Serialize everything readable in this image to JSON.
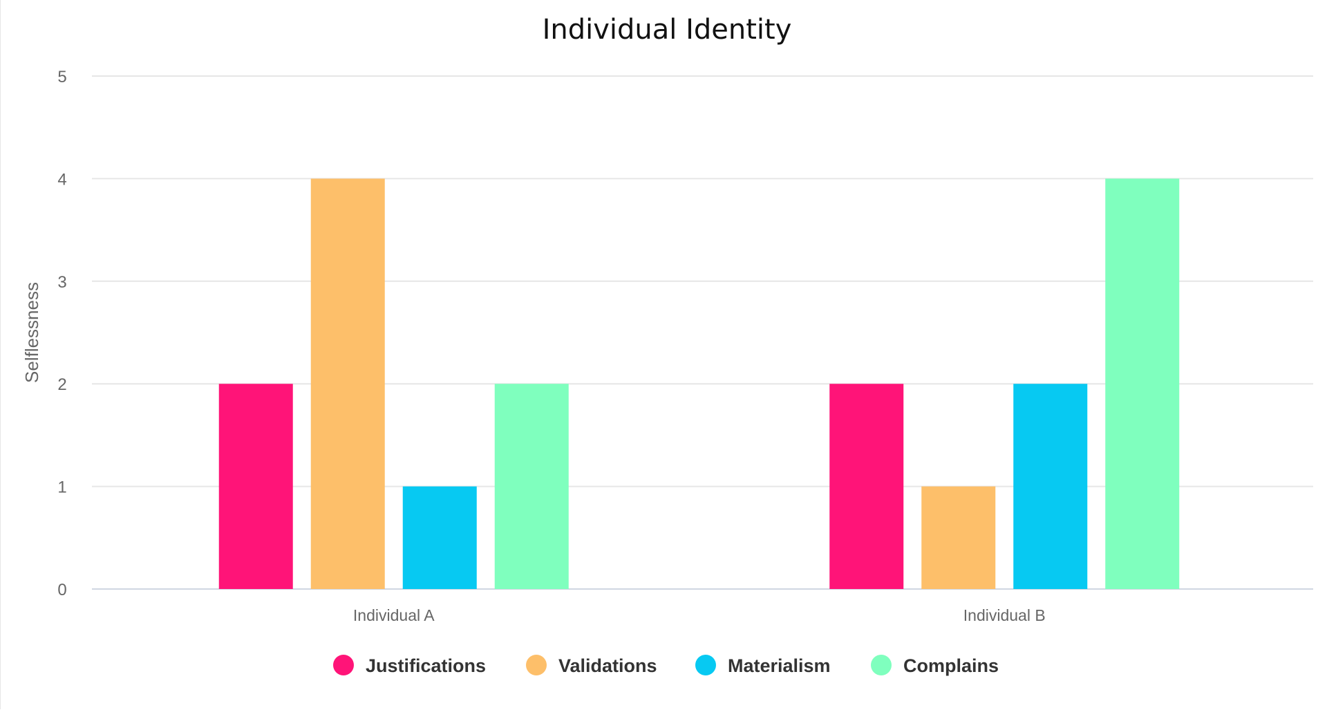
{
  "chart_data": {
    "type": "bar",
    "title": "Individual Identity",
    "xlabel": "",
    "ylabel": "Selflessness",
    "ylim": [
      0,
      5
    ],
    "yticks": [
      0,
      1,
      2,
      3,
      4,
      5
    ],
    "grid": true,
    "legend_position": "bottom",
    "categories": [
      "Individual A",
      "Individual B"
    ],
    "series": [
      {
        "name": "Justifications",
        "color": "#FF1478",
        "values": [
          2,
          2
        ]
      },
      {
        "name": "Validations",
        "color": "#FDBF6A",
        "values": [
          4,
          1
        ]
      },
      {
        "name": "Materialism",
        "color": "#07C9F2",
        "values": [
          1,
          2
        ]
      },
      {
        "name": "Complains",
        "color": "#7FFFBE",
        "values": [
          2,
          4
        ]
      }
    ]
  }
}
